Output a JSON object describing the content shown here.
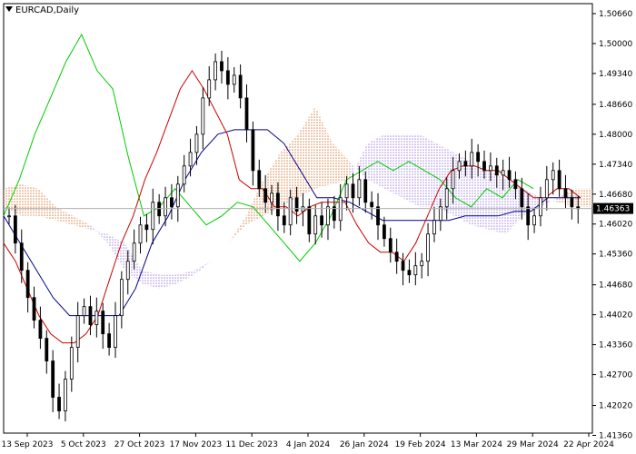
{
  "window": {
    "symbol_title": "EURCAD,Daily"
  },
  "chart_data": {
    "type": "candlestick",
    "title": "EURCAD,Daily",
    "ylim": [
      1.4141,
      1.5088
    ],
    "grid": false,
    "price_ticks": [
      "1.50660",
      "1.50000",
      "1.49340",
      "1.48660",
      "1.48000",
      "1.47340",
      "1.46680",
      "1.46020",
      "1.45360",
      "1.44680",
      "1.44020",
      "1.43360",
      "1.42700",
      "1.42020",
      "1.41360"
    ],
    "date_labels": [
      "13 Sep 2023",
      "5 Oct 2023",
      "27 Oct 2023",
      "17 Nov 2023",
      "11 Dec 2023",
      "4 Jan 2024",
      "26 Jan 2024",
      "19 Feb 2024",
      "13 Mar 2024",
      "29 Mar 2024",
      "22 Apr 2024"
    ],
    "current_price": "1.46363",
    "colors": {
      "tenkan": "#cc0000",
      "kijun": "#00008b",
      "chikou": "#00cc00",
      "kumo_up": "#d2691e",
      "kumo_down": "#9370db",
      "candles": "#000000"
    },
    "indicator": "Ichimoku Kinko Hyo",
    "candles_close": [
      1.462,
      1.456,
      1.45,
      1.444,
      1.439,
      1.435,
      1.43,
      1.422,
      1.419,
      1.426,
      1.433,
      1.44,
      1.442,
      1.438,
      1.441,
      1.436,
      1.433,
      1.44,
      1.448,
      1.452,
      1.456,
      1.46,
      1.459,
      1.465,
      1.462,
      1.466,
      1.464,
      1.469,
      1.473,
      1.476,
      1.48,
      1.488,
      1.492,
      1.496,
      1.494,
      1.491,
      1.493,
      1.488,
      1.481,
      1.472,
      1.468,
      1.465,
      1.467,
      1.462,
      1.46,
      1.466,
      1.463,
      1.464,
      1.458,
      1.462,
      1.46,
      1.464,
      1.461,
      1.466,
      1.469,
      1.466,
      1.47,
      1.465,
      1.464,
      1.46,
      1.457,
      1.454,
      1.452,
      1.45,
      1.449,
      1.451,
      1.452,
      1.458,
      1.461,
      1.464,
      1.468,
      1.472,
      1.474,
      1.473,
      1.476,
      1.474,
      1.472,
      1.473,
      1.471,
      1.472,
      1.47,
      1.468,
      1.464,
      1.46,
      1.462,
      1.466,
      1.47,
      1.472,
      1.468,
      1.466,
      1.464,
      1.4636
    ],
    "tenkan": [
      1.456,
      1.452,
      1.446,
      1.44,
      1.436,
      1.434,
      1.434,
      1.436,
      1.44,
      1.448,
      1.456,
      1.462,
      1.47,
      1.476,
      1.483,
      1.49,
      1.494,
      1.49,
      1.485,
      1.48,
      1.47,
      1.468,
      1.468,
      1.464,
      1.464,
      1.462,
      1.464,
      1.465,
      1.465,
      1.465,
      1.46,
      1.456,
      1.454,
      1.454,
      1.452,
      1.456,
      1.462,
      1.468,
      1.472,
      1.473,
      1.473,
      1.472,
      1.472,
      1.47,
      1.468,
      1.466,
      1.466,
      1.468,
      1.468,
      1.466
    ],
    "kijun": [
      1.462,
      1.456,
      1.45,
      1.444,
      1.44,
      1.44,
      1.44,
      1.44,
      1.446,
      1.456,
      1.462,
      1.47,
      1.476,
      1.48,
      1.481,
      1.481,
      1.481,
      1.478,
      1.472,
      1.466,
      1.466,
      1.465,
      1.463,
      1.461,
      1.461,
      1.461,
      1.461,
      1.461,
      1.462,
      1.462,
      1.462,
      1.463,
      1.463,
      1.466,
      1.466,
      1.466
    ],
    "chikou": [
      1.462,
      1.47,
      1.48,
      1.488,
      1.496,
      1.502,
      1.494,
      1.49,
      1.475,
      1.462,
      1.464,
      1.468,
      1.464,
      1.46,
      1.462,
      1.465,
      1.464,
      1.46,
      1.456,
      1.452,
      1.456,
      1.462,
      1.47,
      1.472,
      1.474,
      1.472,
      1.474,
      1.472,
      1.47,
      1.466,
      1.464,
      1.468,
      1.466,
      1.47,
      1.468
    ]
  }
}
